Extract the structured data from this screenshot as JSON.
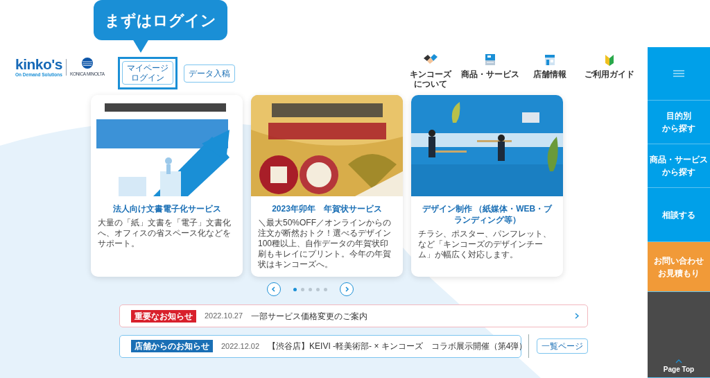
{
  "callout": {
    "text": "まずはログイン"
  },
  "logo": {
    "brand": "kinko's",
    "tagline": "On Demand Solutions",
    "partner": "KONICA MINOLTA"
  },
  "header_buttons": [
    {
      "lines": [
        "マイページ",
        "ログイン"
      ],
      "highlighted": true
    },
    {
      "lines": [
        "データ入稿"
      ],
      "highlighted": false
    }
  ],
  "nav": [
    {
      "kind": "handshake",
      "lines": [
        "キンコーズ",
        "について"
      ]
    },
    {
      "kind": "printer",
      "lines": [
        "商品・サービス"
      ]
    },
    {
      "kind": "store",
      "lines": [
        "店舗情報"
      ]
    },
    {
      "kind": "leaf",
      "lines": [
        "ご利用ガイド"
      ]
    }
  ],
  "side_menu": [
    {
      "kind": "menu"
    },
    {
      "kind": "link",
      "lines": [
        "目的別",
        "から探す"
      ]
    },
    {
      "kind": "link",
      "lines": [
        "商品・サービス",
        "から探す"
      ]
    },
    {
      "kind": "link",
      "lines": [
        "相談する"
      ]
    },
    {
      "kind": "accent",
      "lines": [
        "お問い合わせ",
        "お見積もり"
      ]
    },
    {
      "kind": "top",
      "lines": [
        "Page Top"
      ]
    }
  ],
  "cards": [
    {
      "title": "法人向け文書電子化サービス",
      "text": "大量の「紙」文書を「電子」文書化へ、オフィスの省スペース化などをサポート。"
    },
    {
      "title": "2023年卯年　年賀状サービス",
      "text": "＼最大50%OFF／オンラインからの注文が断然おトク！選べるデザイン100種以上、自作データの年賀状印刷もキレイにプリント。今年の年賀状はキンコーズへ。"
    },
    {
      "title": "デザイン制作 （紙媒体・WEB・ブランディング等）",
      "text": "チラシ、ポスター、パンフレット、など「キンコーズのデザインチーム」が幅広く対応します。"
    }
  ],
  "carousel_dots": [
    {
      "selected": true
    },
    {
      "selected": false
    },
    {
      "selected": false
    },
    {
      "selected": false
    },
    {
      "selected": false
    }
  ],
  "notices": [
    {
      "kind": "important",
      "tag": "重要なお知らせ",
      "date": "2022.10.27",
      "text": "一部サービス価格変更のご案内"
    },
    {
      "kind": "store",
      "tag": "店舗からのお知らせ",
      "date": "2022.12.02",
      "text": "【渋谷店】KEIVI -軽美術部- × キンコーズ　コラボ展示開催（第4弾）"
    }
  ],
  "list_button": "一覧ページ"
}
